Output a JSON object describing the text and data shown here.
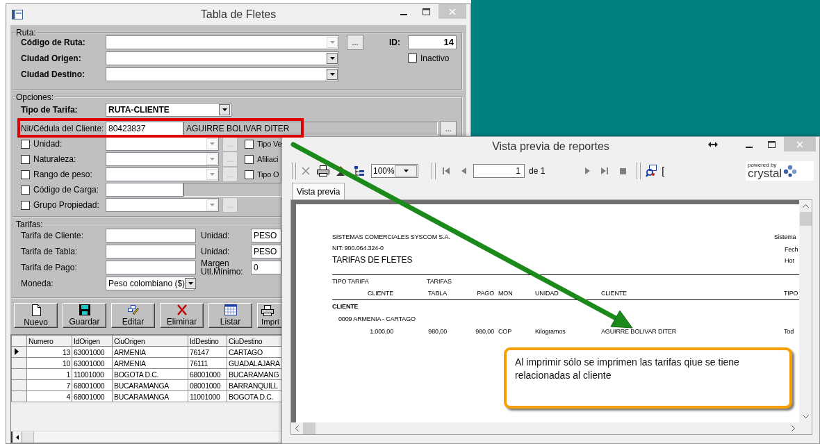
{
  "form_window": {
    "title": "Tabla de Fletes",
    "ruta": {
      "legend": "Ruta:",
      "fields": [
        {
          "label": "Código de Ruta:",
          "disabled": true,
          "button": {
            "label": "...",
            "disabled": false
          }
        },
        {
          "label": "Ciudad Origen:",
          "disabled": false
        },
        {
          "label": "Ciudad Destino:",
          "disabled": false
        }
      ],
      "id_label": "ID:",
      "id_value": "14",
      "inactivo": {
        "label": "Inactivo",
        "checked": false
      }
    },
    "opciones": {
      "legend": "Opciones:",
      "tipo_tarifa": {
        "label": "Tipo de Tarifa:",
        "value": "RUTA-CLIENTE"
      },
      "cliente": {
        "label": "Nit/Cédula del Cliente:",
        "nit": "80423837",
        "name": "AGUIRRE BOLIVAR DITER",
        "button": {
          "label": "...",
          "disabled": false
        }
      },
      "filters": [
        {
          "kind": "combo",
          "label": "Unidad:",
          "checked": false,
          "disabled": true,
          "button": {
            "label": "...",
            "disabled": true
          }
        },
        {
          "kind": "combo",
          "label": "Naturaleza:",
          "checked": false,
          "disabled": true,
          "button": {
            "label": "...",
            "disabled": true
          }
        },
        {
          "kind": "combo",
          "label": "Rango de peso:",
          "checked": false,
          "disabled": true,
          "button": {
            "label": "...",
            "disabled": true
          }
        },
        {
          "kind": "text",
          "label": "Código de Carga:",
          "checked": false
        },
        {
          "kind": "combo",
          "label": "Grupo Propiedad:",
          "checked": false,
          "disabled": true,
          "button": {
            "label": "...",
            "disabled": true
          }
        }
      ],
      "side_checks": [
        {
          "label": "Tipo Ve",
          "checked": false
        },
        {
          "label": "Afiliaci",
          "checked": false
        },
        {
          "label": "Tipo O",
          "checked": false
        }
      ]
    },
    "tarifas": {
      "legend": "Tarifas:",
      "rows": [
        {
          "label": "Tarifa de Cliente:",
          "unit_label": "Unidad:",
          "unit_value": "PESO"
        },
        {
          "label": "Tarifa de Tabla:",
          "unit_label": "Unidad:",
          "unit_value": "PESO"
        },
        {
          "label": "Tarifa de Pago:",
          "unit_label": "Margen Utl.Mínimo:",
          "unit_value": "0"
        }
      ],
      "moneda": {
        "label": "Moneda:",
        "value": "Peso colombiano ($)"
      }
    },
    "toolbar": [
      {
        "kind": "new",
        "label": "Nuevo"
      },
      {
        "kind": "save",
        "label": "Guardar"
      },
      {
        "kind": "edit",
        "label": "Editar"
      },
      {
        "kind": "delete",
        "label": "Eliminar"
      },
      {
        "kind": "list",
        "label": "Listar"
      },
      {
        "kind": "print",
        "label": "Impri"
      }
    ],
    "grid": {
      "columns": [
        "Numero",
        "IdOrigen",
        "CiuOrigen",
        "IdDestino",
        "CiuDestino"
      ],
      "rows": [
        {
          "selected": true,
          "cells": [
            "13",
            "63001000",
            "ARMENIA",
            "76147",
            "CARTAGO"
          ]
        },
        {
          "selected": false,
          "cells": [
            "10",
            "63001000",
            "ARMENIA",
            "76111",
            "GUADALAJARA"
          ]
        },
        {
          "selected": false,
          "cells": [
            "1",
            "11001000",
            "BOGOTA D.C.",
            "68001000",
            "BUCARAMANG"
          ]
        },
        {
          "selected": false,
          "cells": [
            "7",
            "68001000",
            "BUCARAMANGA",
            "08001000",
            "BARRANQUILL"
          ]
        },
        {
          "selected": false,
          "cells": [
            "4",
            "68001000",
            "BUCARAMANGA",
            "11001000",
            "BOGOTA D.C."
          ]
        }
      ]
    }
  },
  "report_window": {
    "title": "Vista previa de reportes",
    "zoom": "100%",
    "page": "1",
    "page_count": "de 1",
    "bracket": "[",
    "logo": {
      "tagline": "powered by",
      "name": "crystal"
    },
    "tabs": [
      {
        "label": "Vista previa",
        "selected": true
      }
    ],
    "report": {
      "company": "SISTEMAS COMERCIALES SYSCOM S.A.",
      "nit": "NIT: 900.064.324-0",
      "title": "TARIFAS DE FLETES",
      "right_labels": [
        "Sistema",
        "Fech",
        "Hor"
      ],
      "header1": [
        "TIPO TARIFA",
        "TARIFAS"
      ],
      "header2": [
        "CLIENTE",
        "TABLA",
        "PAGO",
        "MON",
        "UNIDAD",
        "CLIENTE",
        "TIPO"
      ],
      "group": "CLIENTE",
      "route": "0009 ARMENIA - CARTAGO",
      "rows": [
        [
          "1.000,00",
          "980,00",
          "980,00",
          "COP",
          "Kilogramos",
          "AGUIRRE BOLIVAR DITER",
          "Tod"
        ]
      ]
    }
  },
  "callout": {
    "text": "Al imprimir sólo se imprimen las tarifas qiue se tiene relacionadas al cliente"
  }
}
